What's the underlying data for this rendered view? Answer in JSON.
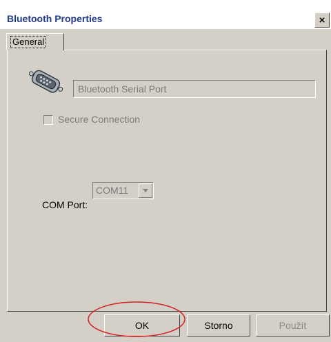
{
  "window": {
    "title": "Bluetooth Properties",
    "close_glyph": "×"
  },
  "tabs": [
    {
      "label": "General"
    }
  ],
  "general": {
    "service_name": "Bluetooth Serial Port",
    "secure_connection_label": "Secure Connection",
    "secure_connection_checked": false,
    "com_port_label": "COM Port:",
    "com_port_value": "COM11"
  },
  "buttons": {
    "ok": "OK",
    "cancel": "Storno",
    "apply": "Použít"
  },
  "colors": {
    "title_text": "#1f3a8a",
    "face": "#d4d0c8",
    "annotation": "#d42020"
  },
  "icons": {
    "port": "serial-port-icon"
  }
}
